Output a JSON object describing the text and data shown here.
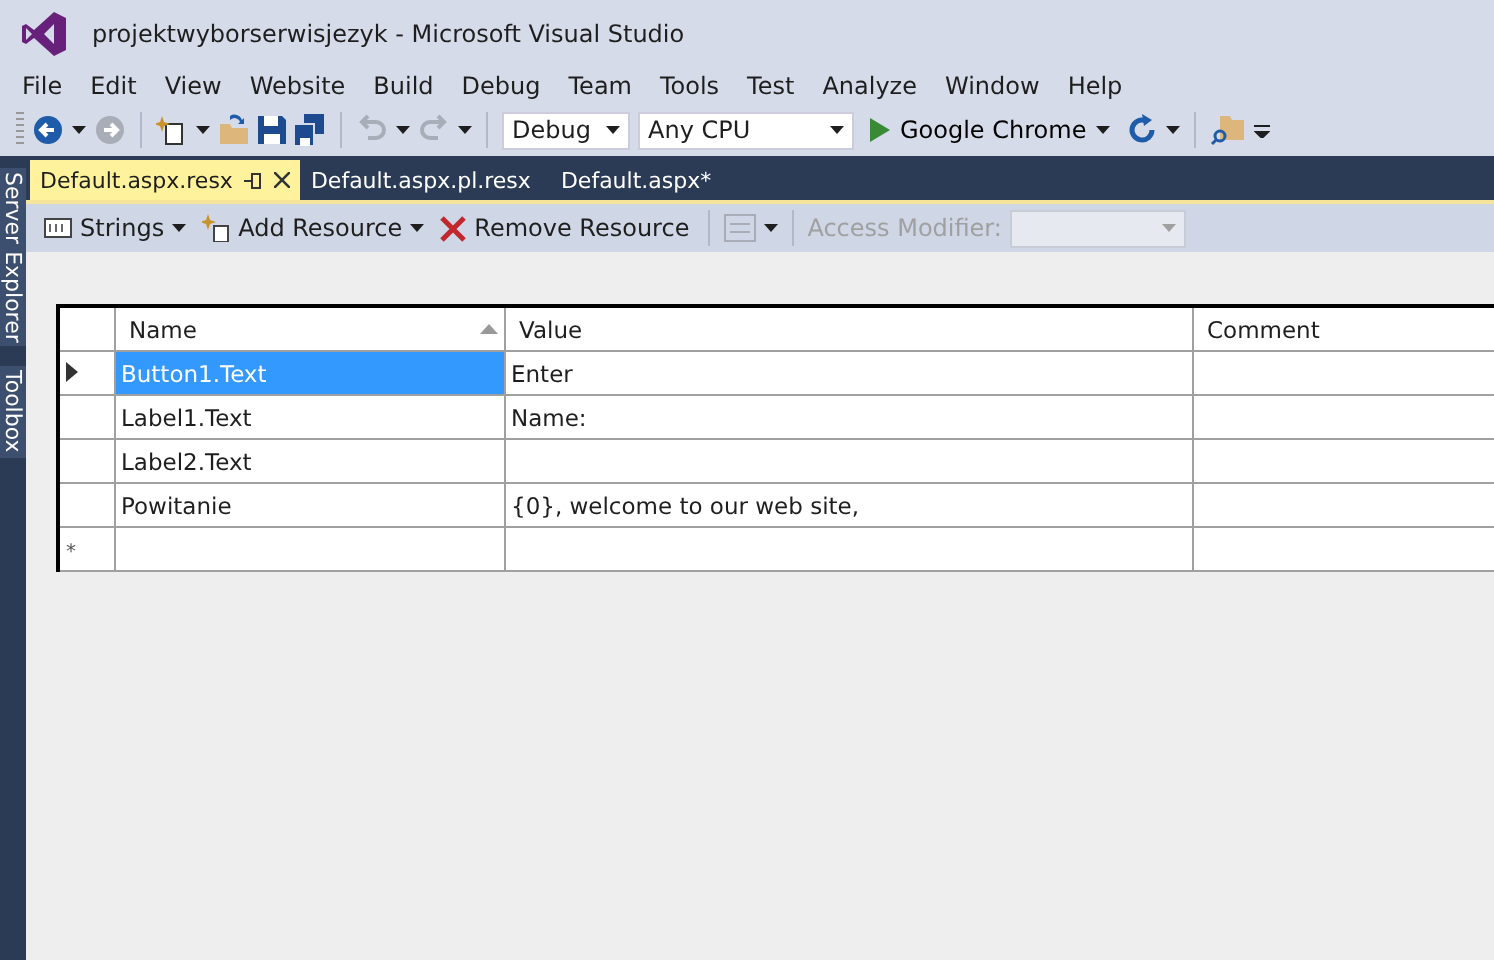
{
  "window": {
    "title": "projektwyborserwisjezyk - Microsoft Visual Studio"
  },
  "menu": [
    "File",
    "Edit",
    "View",
    "Website",
    "Build",
    "Debug",
    "Team",
    "Tools",
    "Test",
    "Analyze",
    "Window",
    "Help"
  ],
  "toolbar": {
    "configuration": "Debug",
    "platform": "Any CPU",
    "run_target": "Google Chrome"
  },
  "side_tabs": [
    "Server Explorer",
    "Toolbox"
  ],
  "doc_tabs": [
    {
      "label": "Default.aspx.resx",
      "selected": true
    },
    {
      "label": "Default.aspx.pl.resx",
      "selected": false
    },
    {
      "label": "Default.aspx*",
      "selected": false
    }
  ],
  "resource_toolbar": {
    "strings": "Strings",
    "add": "Add Resource",
    "remove": "Remove Resource",
    "access_modifier": {
      "label": "Access Modifier:",
      "disabled": true
    }
  },
  "table": {
    "columns": [
      "Name",
      "Value",
      "Comment"
    ],
    "rows": [
      {
        "name": "Button1.Text",
        "value": "Enter",
        "selected": true
      },
      {
        "name": "Label1.Text",
        "value": "Name:",
        "selected": false
      },
      {
        "name": "Label2.Text",
        "value": "",
        "selected": false
      },
      {
        "name": "Powitanie",
        "value": "{0}, welcome to our web site,",
        "selected": false
      }
    ],
    "new_row_marker": "*"
  }
}
